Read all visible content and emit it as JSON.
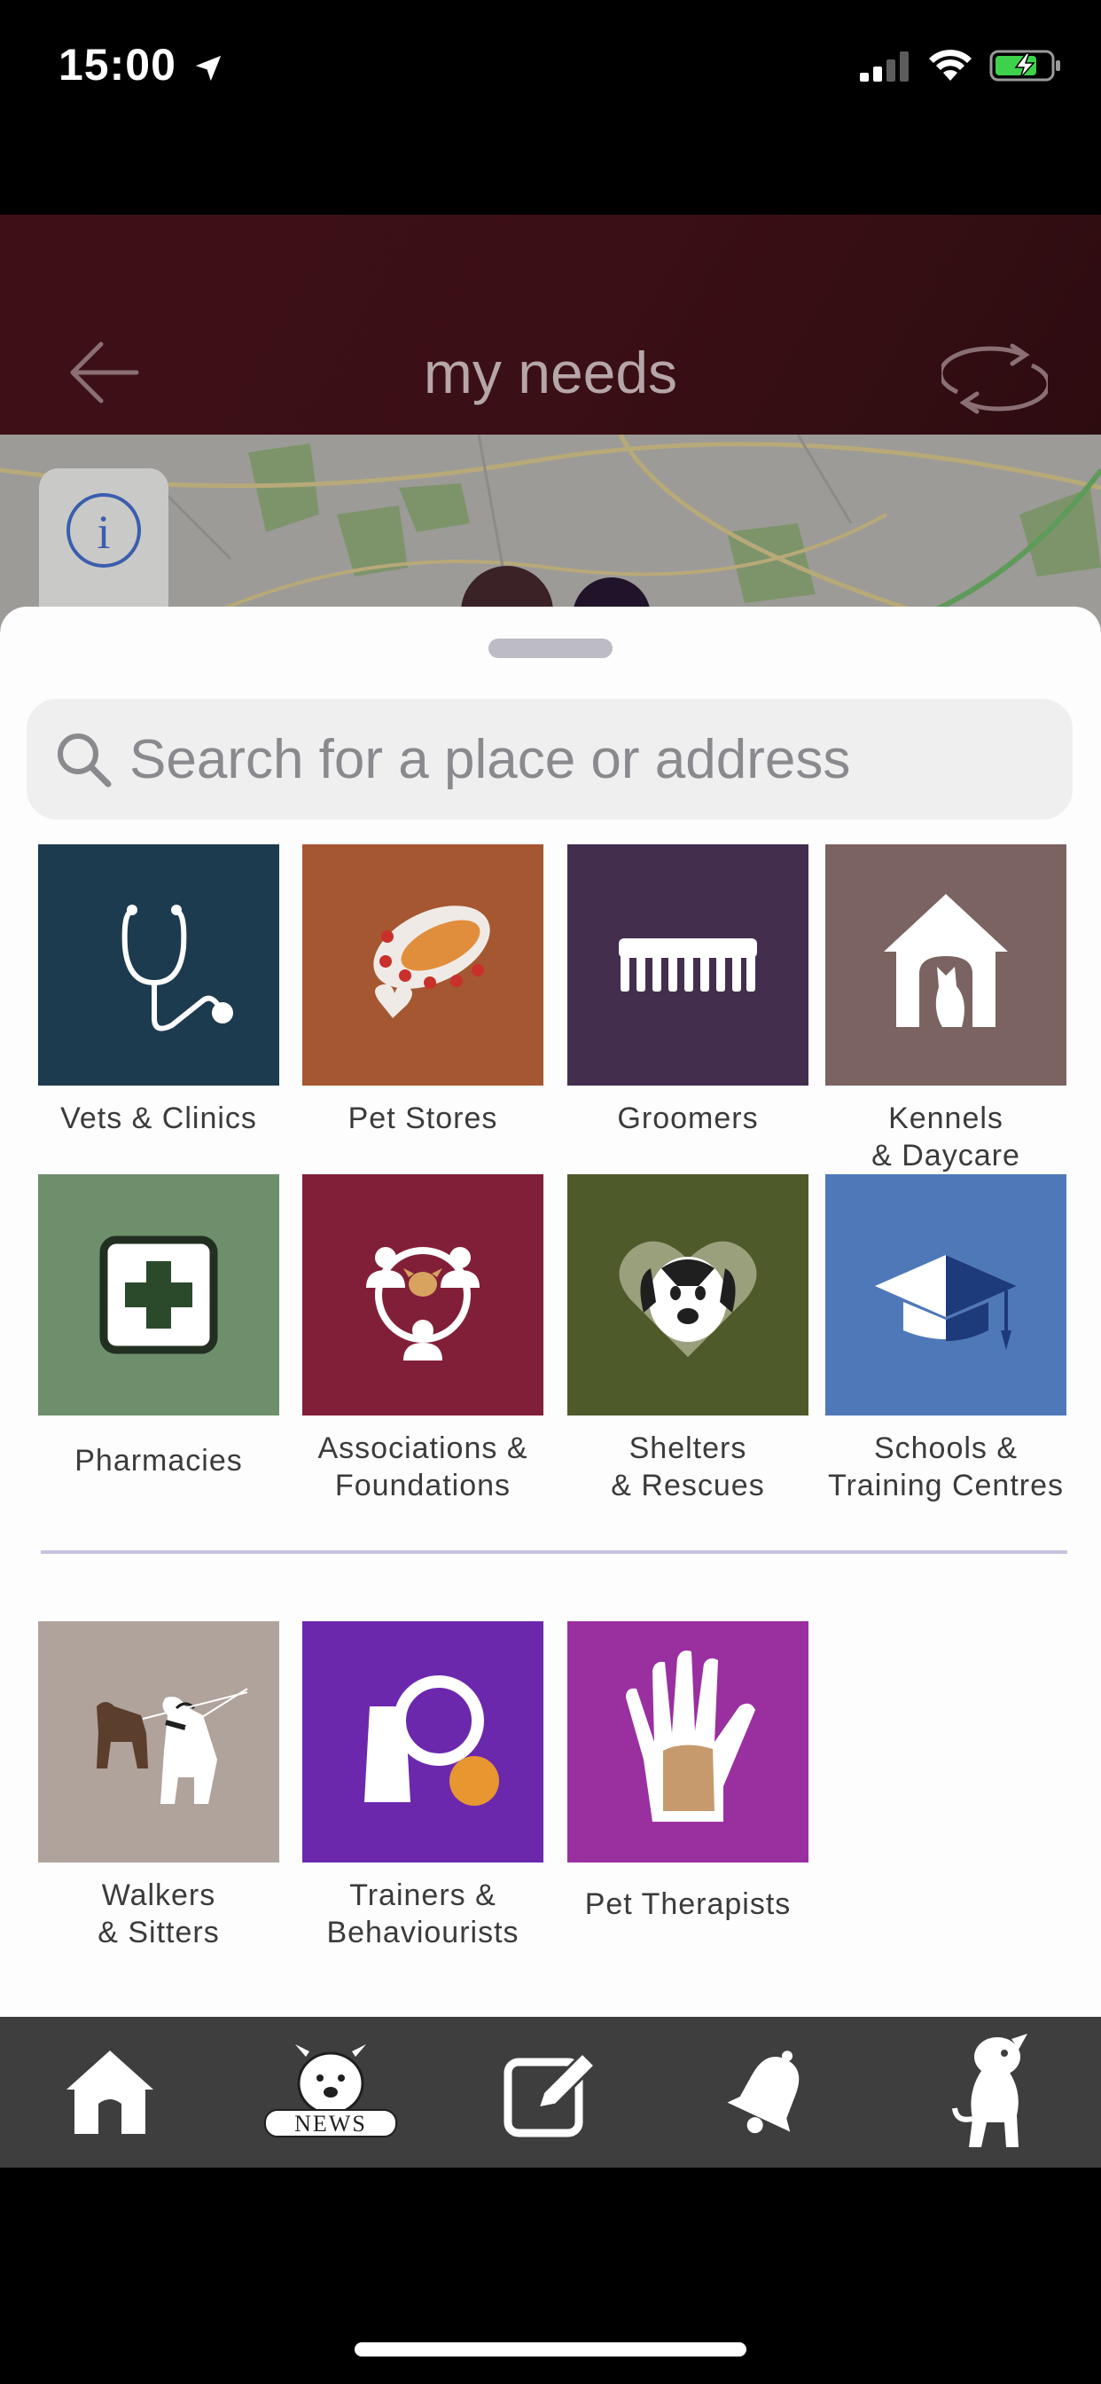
{
  "status": {
    "time": "15:00"
  },
  "header": {
    "title": "my needs"
  },
  "search": {
    "placeholder": "Search for a place or address"
  },
  "categories": [
    {
      "label": "Vets & Clinics",
      "color": "#1d3b4f",
      "icon": "stethoscope-icon"
    },
    {
      "label": "Pet Stores",
      "color": "#a45730",
      "icon": "collar-icon"
    },
    {
      "label": "Groomers",
      "color": "#432e4d",
      "icon": "comb-icon"
    },
    {
      "label": "Kennels\n& Daycare",
      "color": "#7a6360",
      "icon": "kennel-icon"
    },
    {
      "label": "Pharmacies",
      "color": "#6e8f6c",
      "icon": "first-aid-icon"
    },
    {
      "label": "Associations &\nFoundations",
      "color": "#821f38",
      "icon": "community-icon"
    },
    {
      "label": "Shelters\n& Rescues",
      "color": "#4f5a2b",
      "icon": "dog-heart-icon"
    },
    {
      "label": "Schools &\nTraining Centres",
      "color": "#4f78b9",
      "icon": "graduation-cap-icon"
    }
  ],
  "services": [
    {
      "label": "Walkers\n& Sitters",
      "color": "#b0a39b",
      "icon": "dog-walker-icon"
    },
    {
      "label": "Trainers &\nBehaviourists",
      "color": "#6b28ad",
      "icon": "trainer-icon"
    },
    {
      "label": "Pet Therapists",
      "color": "#9a2fa0",
      "icon": "therapy-hand-icon"
    }
  ],
  "tabs": [
    {
      "icon": "home-icon"
    },
    {
      "icon": "news-icon",
      "text": "NEWS"
    },
    {
      "icon": "edit-icon"
    },
    {
      "icon": "bell-icon"
    },
    {
      "icon": "dog-profile-icon"
    }
  ]
}
